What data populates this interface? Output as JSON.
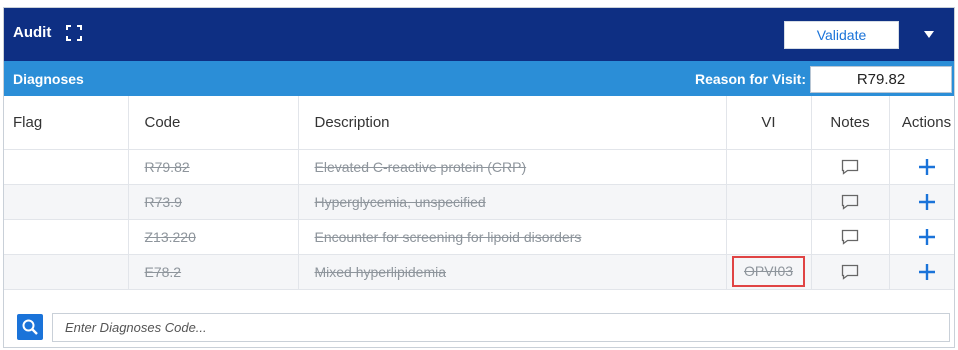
{
  "header": {
    "title": "Audit",
    "validate_label": "Validate",
    "expand_icon": "expand-icon",
    "dropdown_icon": "caret-down-icon"
  },
  "diagnoses": {
    "section_label": "Diagnoses",
    "reason_label": "Reason for Visit:",
    "reason_value": "R79.82"
  },
  "table": {
    "columns": [
      "Flag",
      "Code",
      "Description",
      "VI",
      "Notes",
      "Actions"
    ],
    "rows": [
      {
        "flag": "",
        "code": "R79.82",
        "description": "Elevated C-reactive protein (CRP)",
        "vi": ""
      },
      {
        "flag": "",
        "code": "R73.9",
        "description": "Hyperglycemia, unspecified",
        "vi": ""
      },
      {
        "flag": "",
        "code": "Z13.220",
        "description": "Encounter for screening for lipoid disorders",
        "vi": ""
      },
      {
        "flag": "",
        "code": "E78.2",
        "description": "Mixed hyperlipidemia",
        "vi": "OPVI03"
      }
    ],
    "notes_icon": "comment-icon",
    "actions_icon": "plus-icon"
  },
  "search": {
    "placeholder": "Enter Diagnoses Code...",
    "icon": "search-icon"
  },
  "colors": {
    "header_bg": "#0e2f83",
    "subheader_bg": "#2b8ed7",
    "accent": "#1a73d9",
    "highlight": "#e04444"
  }
}
